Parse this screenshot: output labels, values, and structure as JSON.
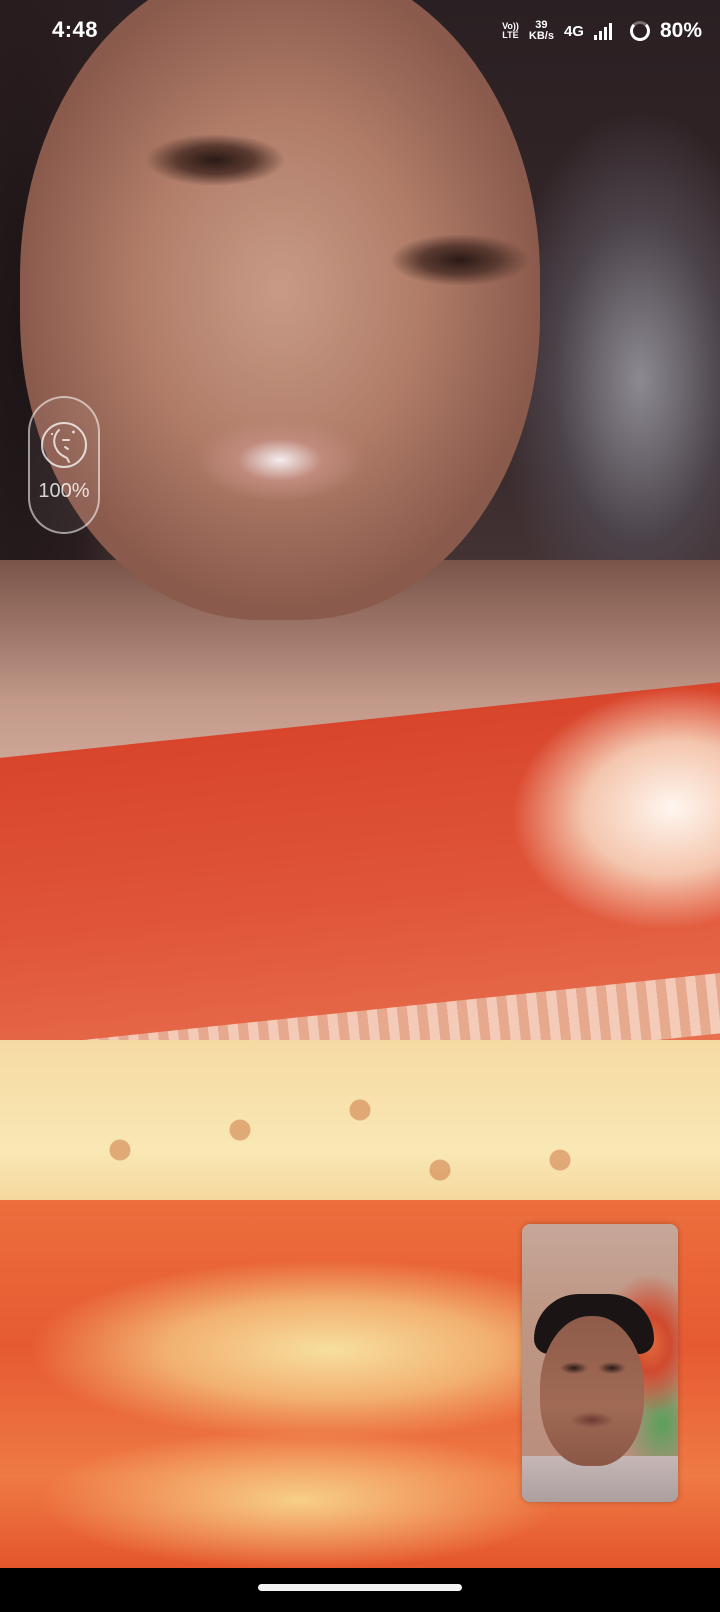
{
  "status_bar": {
    "time": "4:48",
    "volte_top": "Vo))",
    "volte_bottom": "LTE",
    "speed_value": "39",
    "speed_unit": "KB/s",
    "network_type": "4G",
    "battery_percent": "80%"
  },
  "beauty_filter": {
    "icon": "beauty-face-icon",
    "value": "100%"
  },
  "colors": {
    "status_text": "#ffffff",
    "nav_handle": "#f2f2f2"
  }
}
